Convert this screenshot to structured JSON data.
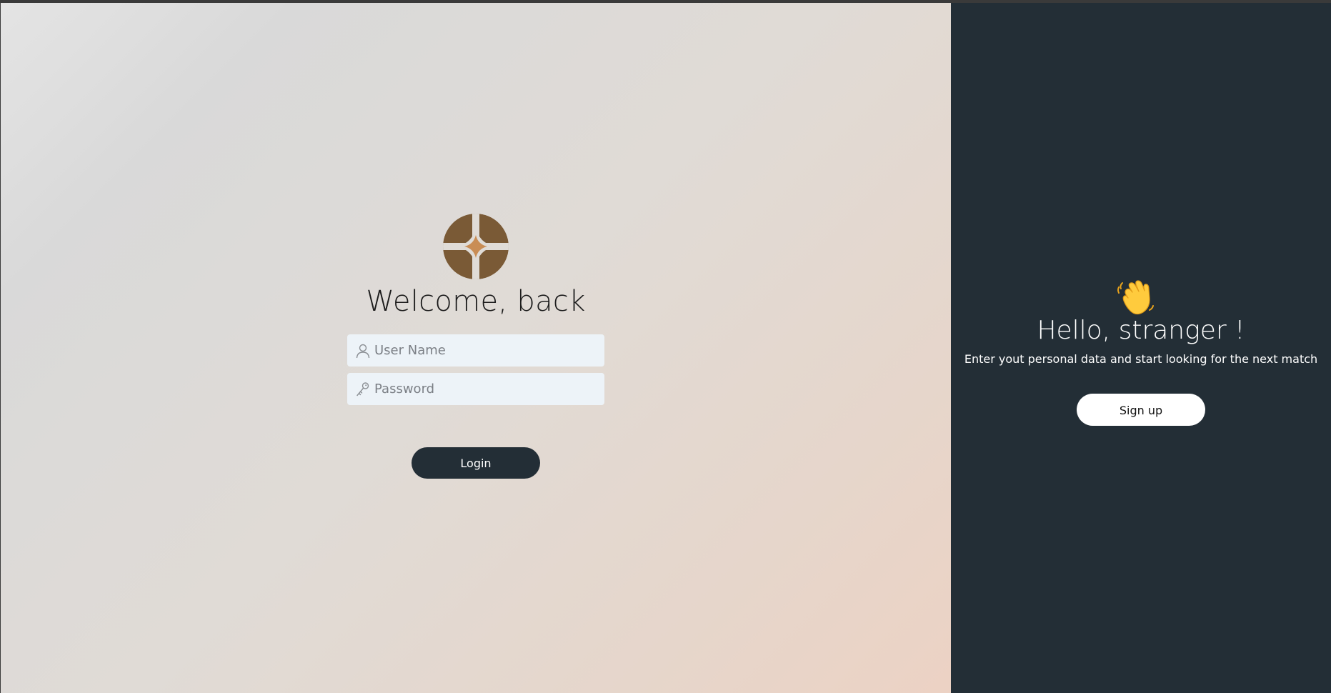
{
  "colors": {
    "dark_panel": "#232e36",
    "logo_brown": "#7a5a36",
    "logo_accent": "#c98d55",
    "input_bg": "#edf3f8"
  },
  "login": {
    "logo_icon": "compass-star-logo",
    "title": "Welcome, back",
    "username": {
      "icon": "user-icon",
      "placeholder": "User Name",
      "value": ""
    },
    "password": {
      "icon": "key-icon",
      "placeholder": "Password",
      "value": ""
    },
    "login_label": "Login"
  },
  "signup_panel": {
    "emoji_icon": "waving-hand-icon",
    "title": "Hello, stranger !",
    "subtitle": "Enter yout personal data and start looking for the next match",
    "signup_label": "Sign up"
  }
}
